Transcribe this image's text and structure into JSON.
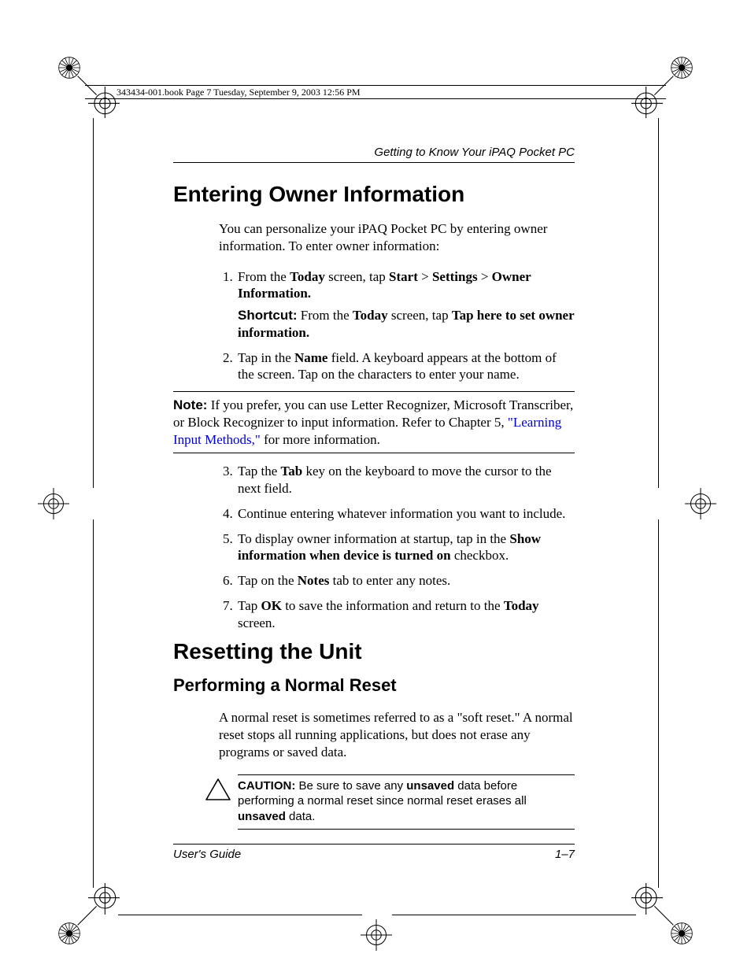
{
  "stamp": "343434-001.book  Page 7  Tuesday, September 9, 2003  12:56 PM",
  "chapter_header": "Getting to Know Your iPAQ Pocket PC",
  "h1a": "Entering Owner Information",
  "intro": "You can personalize your iPAQ Pocket PC by entering owner information. To enter owner information:",
  "step1": {
    "pre": "From the ",
    "b1": "Today",
    "mid1": " screen, tap ",
    "b2": "Start",
    "gt1": " > ",
    "b3": "Settings",
    "gt2": " > ",
    "b4": "Owner Information."
  },
  "shortcut": {
    "label": "Shortcut:",
    "pre": " From the ",
    "b1": "Today",
    "mid": " screen, tap ",
    "b2": "Tap here to set owner information."
  },
  "step2": {
    "pre": "Tap in the ",
    "b1": "Name",
    "post": " field. A keyboard appears at the bottom of the screen. Tap on the characters to enter your name."
  },
  "note": {
    "label": "Note:",
    "pre": " If you prefer, you can use Letter Recognizer, Microsoft Transcriber, or Block Recognizer to input information. Refer to Chapter 5, ",
    "link": "\"Learning Input Methods,\"",
    "post": " for more information."
  },
  "step3": {
    "pre": "Tap the ",
    "b1": "Tab",
    "post": " key on the keyboard to move the cursor to the next field."
  },
  "step4": "Continue entering whatever information you want to include.",
  "step5": {
    "pre": "To display owner information at startup, tap in the ",
    "b1": "Show information when device is turned on",
    "post": " checkbox."
  },
  "step6": {
    "pre": "Tap on the ",
    "b1": "Notes",
    "post": " tab to enter any notes."
  },
  "step7": {
    "pre": "Tap ",
    "b1": "OK",
    "mid": " to save the information and return to the ",
    "b2": "Today",
    "post": " screen."
  },
  "h1b": "Resetting the Unit",
  "h2a": "Performing a Normal Reset",
  "reset_para": "A normal reset is sometimes referred to as a \"soft reset.\" A normal reset stops all running applications, but does not erase any programs or saved data.",
  "caution": {
    "label": "CAUTION:",
    "pre": " Be sure to save any ",
    "b1": "unsaved",
    "mid": " data before performing a normal reset since normal reset erases all ",
    "b2": "unsaved",
    "post": " data."
  },
  "footer_left": "User's Guide",
  "footer_right": "1–7"
}
